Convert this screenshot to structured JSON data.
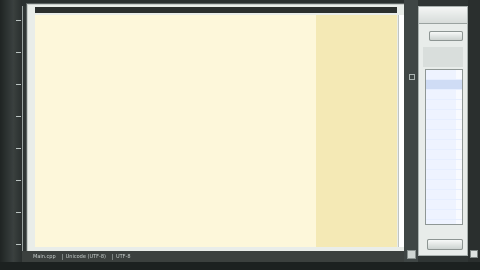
{
  "status_bar": {
    "items": [
      "Main.cpp",
      "Unicode (UTF-8)",
      "UTF-8"
    ]
  },
  "side_panel": {
    "top_button_label": "",
    "footer_button_label": "",
    "list_row_count": 16
  },
  "colors": {
    "page": "#fdf7da",
    "margin": "#f4e9b5",
    "chrome": "#2f3534",
    "panel": "#e8ecea"
  }
}
